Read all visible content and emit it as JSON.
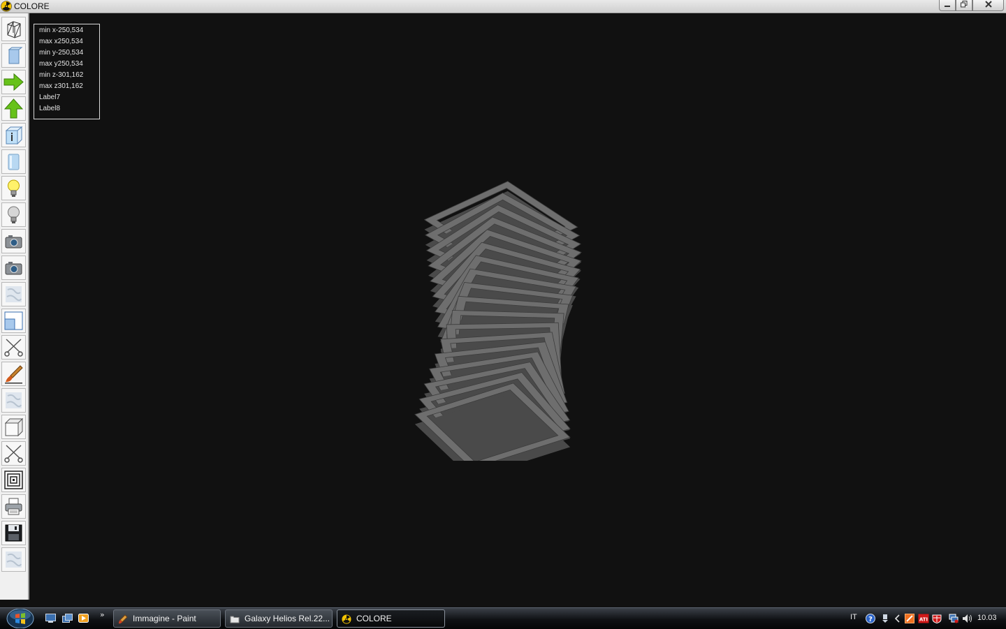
{
  "window": {
    "title": "COLORE"
  },
  "info_panel": {
    "lines": [
      "min x-250,534",
      "max x250,534",
      "min y-250,534",
      "max y250,534",
      "min z-301,162",
      "max z301,162",
      "Label7",
      "Label8"
    ]
  },
  "toolbar": {
    "tools": [
      "wireframe",
      "solid-box",
      "arrow-right",
      "arrow-up",
      "info-box",
      "glass-box",
      "light-on",
      "light-off",
      "camera",
      "camera-2",
      "texture",
      "viewport",
      "cut",
      "paintbrush",
      "texture-2",
      "cube",
      "cut-2",
      "spiral",
      "printer",
      "save",
      "texture-3"
    ]
  },
  "taskbar": {
    "tasks": [
      {
        "label": "Immagine - Paint",
        "icon": "paint-icon"
      },
      {
        "label": "Galaxy Helios  Rel.22...",
        "icon": "folder-icon"
      },
      {
        "label": "COLORE",
        "icon": "colore-icon",
        "active": true
      }
    ],
    "language": "IT",
    "clock": "10.03",
    "more_glyph": "»"
  },
  "colors": {
    "viewport_bg": "#111111",
    "model_face": "#6e6e6e",
    "model_side": "#4a4a4a"
  }
}
